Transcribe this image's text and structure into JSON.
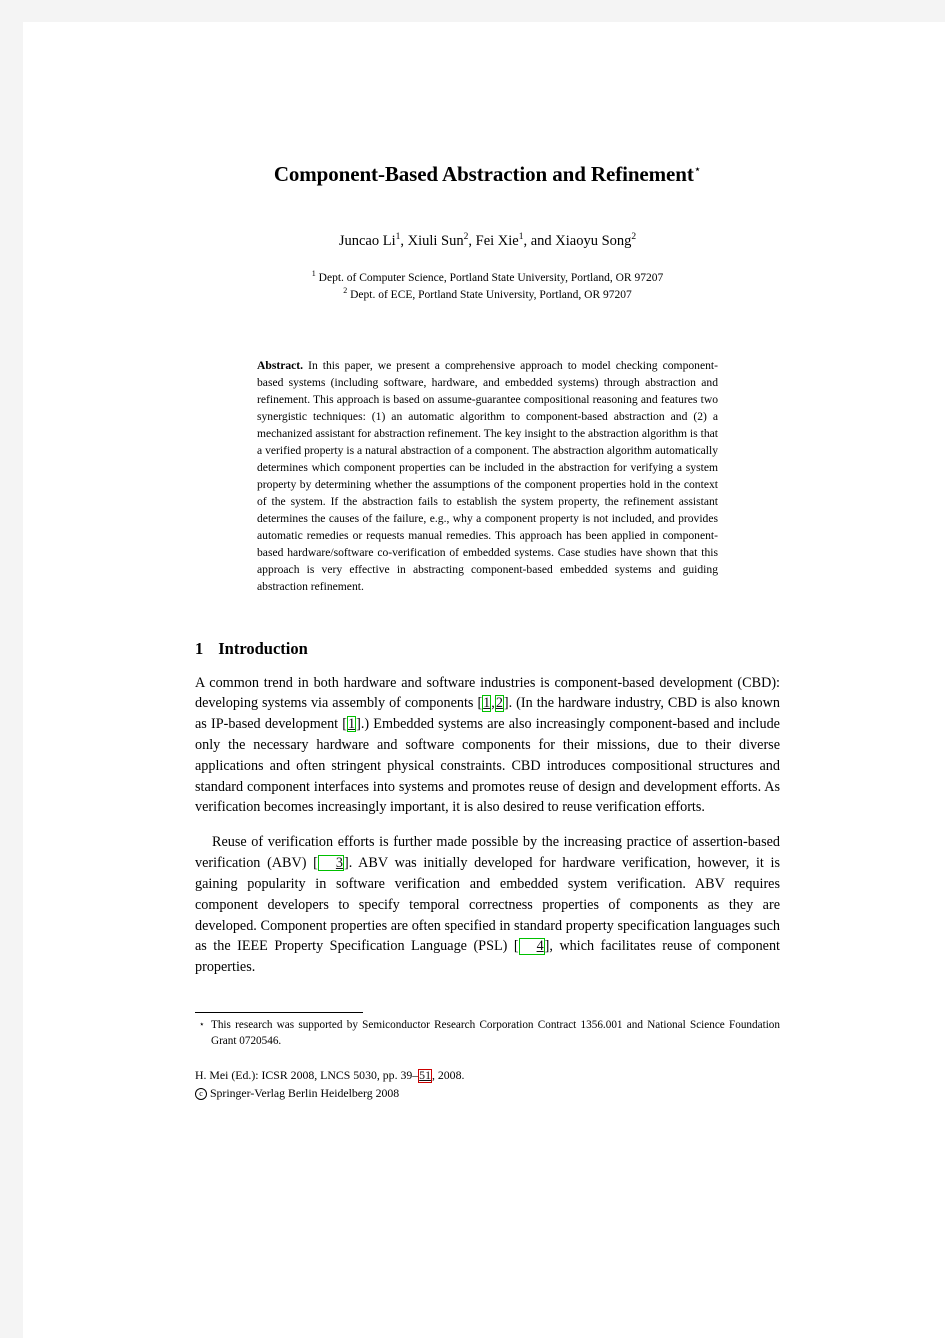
{
  "paper": {
    "title": "Component-Based Abstraction and Refinement",
    "title_footnote_mark": "⋆",
    "authors": [
      {
        "name": "Juncao Li",
        "affil": "1",
        "sep": ", "
      },
      {
        "name": "Xiuli Sun",
        "affil": "2",
        "sep": ", "
      },
      {
        "name": "Fei Xie",
        "affil": "1",
        "sep": ", and "
      },
      {
        "name": "Xiaoyu Song",
        "affil": "2",
        "sep": ""
      }
    ],
    "affiliations": [
      {
        "mark": "1",
        "text": "Dept. of Computer Science, Portland State University, Portland, OR 97207"
      },
      {
        "mark": "2",
        "text": "Dept. of ECE, Portland State University, Portland, OR 97207"
      }
    ],
    "abstract": {
      "label": "Abstract.",
      "text": "In this paper, we present a comprehensive approach to model checking component-based systems (including software, hardware, and embedded systems) through abstraction and refinement. This approach is based on assume-guarantee compositional reasoning and features two synergistic techniques: (1) an automatic algorithm to component-based abstraction and (2) a mechanized assistant for abstraction refinement. The key insight to the abstraction algorithm is that a verified property is a natural abstraction of a component. The abstraction algorithm automatically determines which component properties can be included in the abstraction for verifying a system property by determining whether the assumptions of the component properties hold in the context of the system. If the abstraction fails to establish the system property, the refinement assistant determines the causes of the failure, e.g., why a component property is not included, and provides automatic remedies or requests manual remedies. This approach has been applied in component-based hardware/software co-verification of embedded systems. Case studies have shown that this approach is very effective in abstracting component-based embedded systems and guiding abstraction refinement."
    },
    "section": {
      "number": "1",
      "title": "Introduction"
    },
    "paragraph1": {
      "part1": "A common trend in both hardware and software industries is component-based development (CBD): developing systems via assembly of components ",
      "cite1a": "1",
      "cite1sep": ",",
      "cite1b": "2",
      "part2": ". (In the hardware industry, CBD is also known as IP-based development ",
      "cite2": "1",
      "part3": ".) Embedded systems are also increasingly component-based and include only the necessary hardware and software components for their missions, due to their diverse applications and often stringent physical constraints. CBD introduces compositional structures and standard component interfaces into systems and promotes reuse of design and development efforts. As verification becomes increasingly important, it is also desired to reuse verification efforts."
    },
    "paragraph2": {
      "part1": "Reuse of verification efforts is further made possible by the increasing practice of assertion-based verification (ABV) ",
      "cite3": "3",
      "part2": ". ABV was initially developed for hardware verification, however, it is gaining popularity in software verification and embedded system verification. ABV requires component developers to specify temporal correctness properties of components as they are developed. Component properties are often specified in standard property specification languages such as the IEEE Property Specification Language (PSL) ",
      "cite4": "4",
      "part3": ", which facilitates reuse of component properties."
    },
    "footnote": {
      "mark": "⋆",
      "text": "This research was supported by Semiconductor Research Corporation Contract 1356.001 and National Science Foundation Grant 0720546."
    },
    "publication_footer": {
      "line1_pre": "H. Mei (Ed.): ICSR 2008, LNCS 5030, pp. 39–",
      "line1_link": "51",
      "line1_post": ", 2008.",
      "copyright_symbol": "c",
      "line2": "Springer-Verlag Berlin Heidelberg 2008"
    },
    "colors": {
      "link_box_green": "#00c000",
      "link_box_red": "#cc0000",
      "page_background": "#ffffff",
      "viewer_background": "#f4f4f4",
      "text": "#000000"
    }
  }
}
